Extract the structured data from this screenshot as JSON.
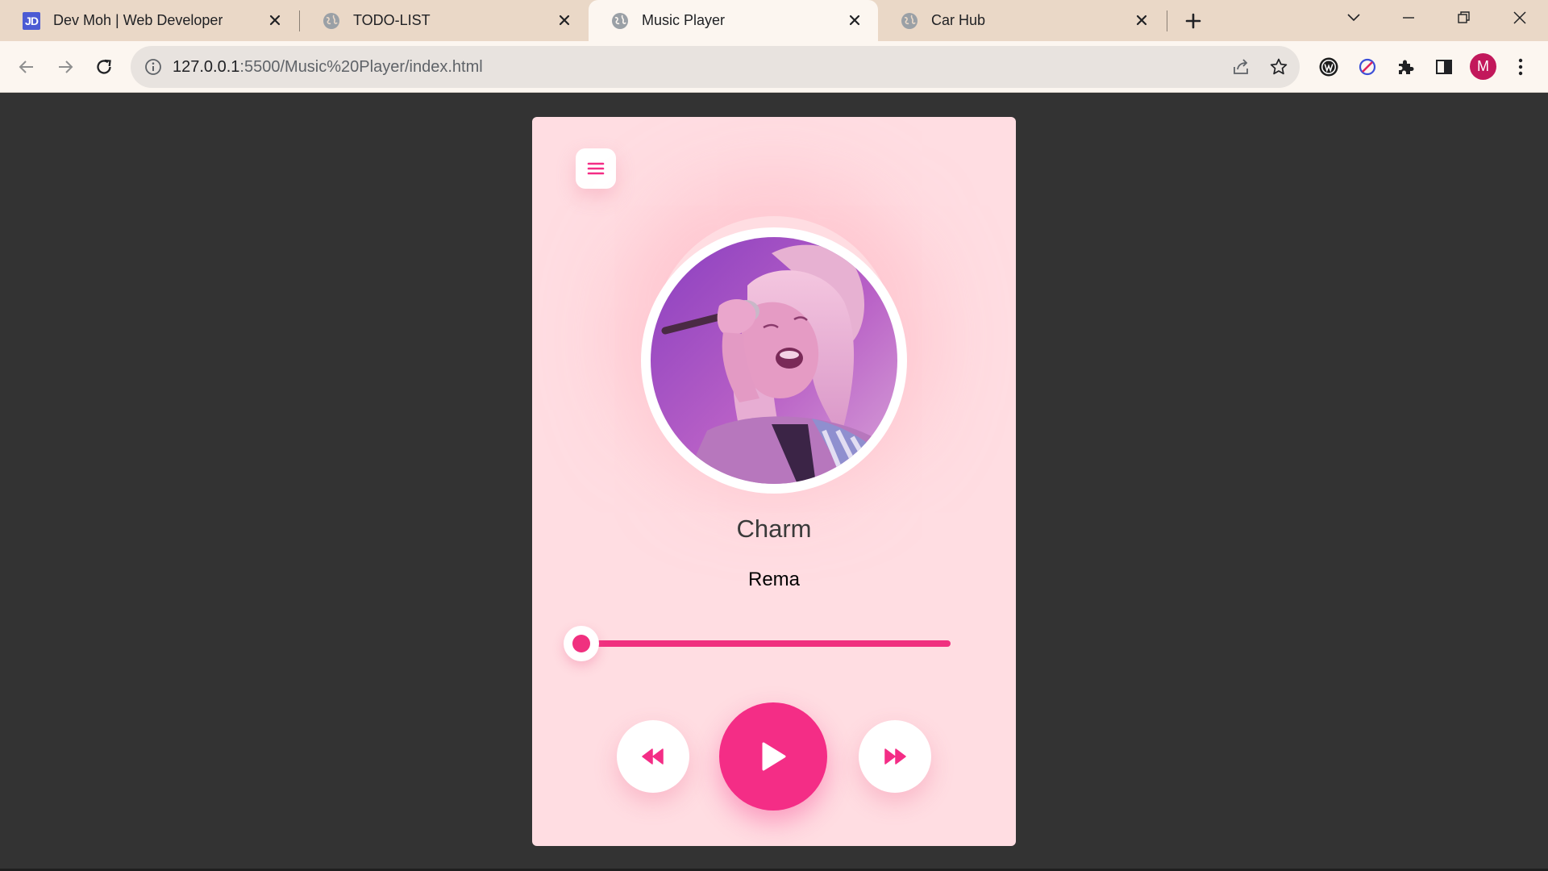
{
  "browser": {
    "tabs": [
      {
        "title": "Dev Moh | Web Developer",
        "favicon": "JD",
        "active": false
      },
      {
        "title": "TODO-LIST",
        "favicon": "globe-icon",
        "active": false
      },
      {
        "title": "Music Player",
        "favicon": "globe-icon",
        "active": true
      },
      {
        "title": "Car Hub",
        "favicon": "globe-icon",
        "active": false
      }
    ],
    "address": {
      "host": "127.0.0.1",
      "path": ":5500/Music%20Player/index.html"
    },
    "profile_initial": "M",
    "colors": {
      "tabbar": "#ead8c7",
      "toolbar": "#fcf6f0",
      "profile": "#c2185b"
    }
  },
  "player": {
    "song_title": "Charm",
    "artist": "Rema",
    "progress": 0.0,
    "icons": {
      "menu": "hamburger-menu-icon",
      "previous": "rewind-icon",
      "play": "play-icon",
      "next": "fast-forward-icon"
    },
    "colors": {
      "accent": "#f42d86",
      "card_background": "#ffdde2",
      "page_background": "#333333"
    }
  }
}
